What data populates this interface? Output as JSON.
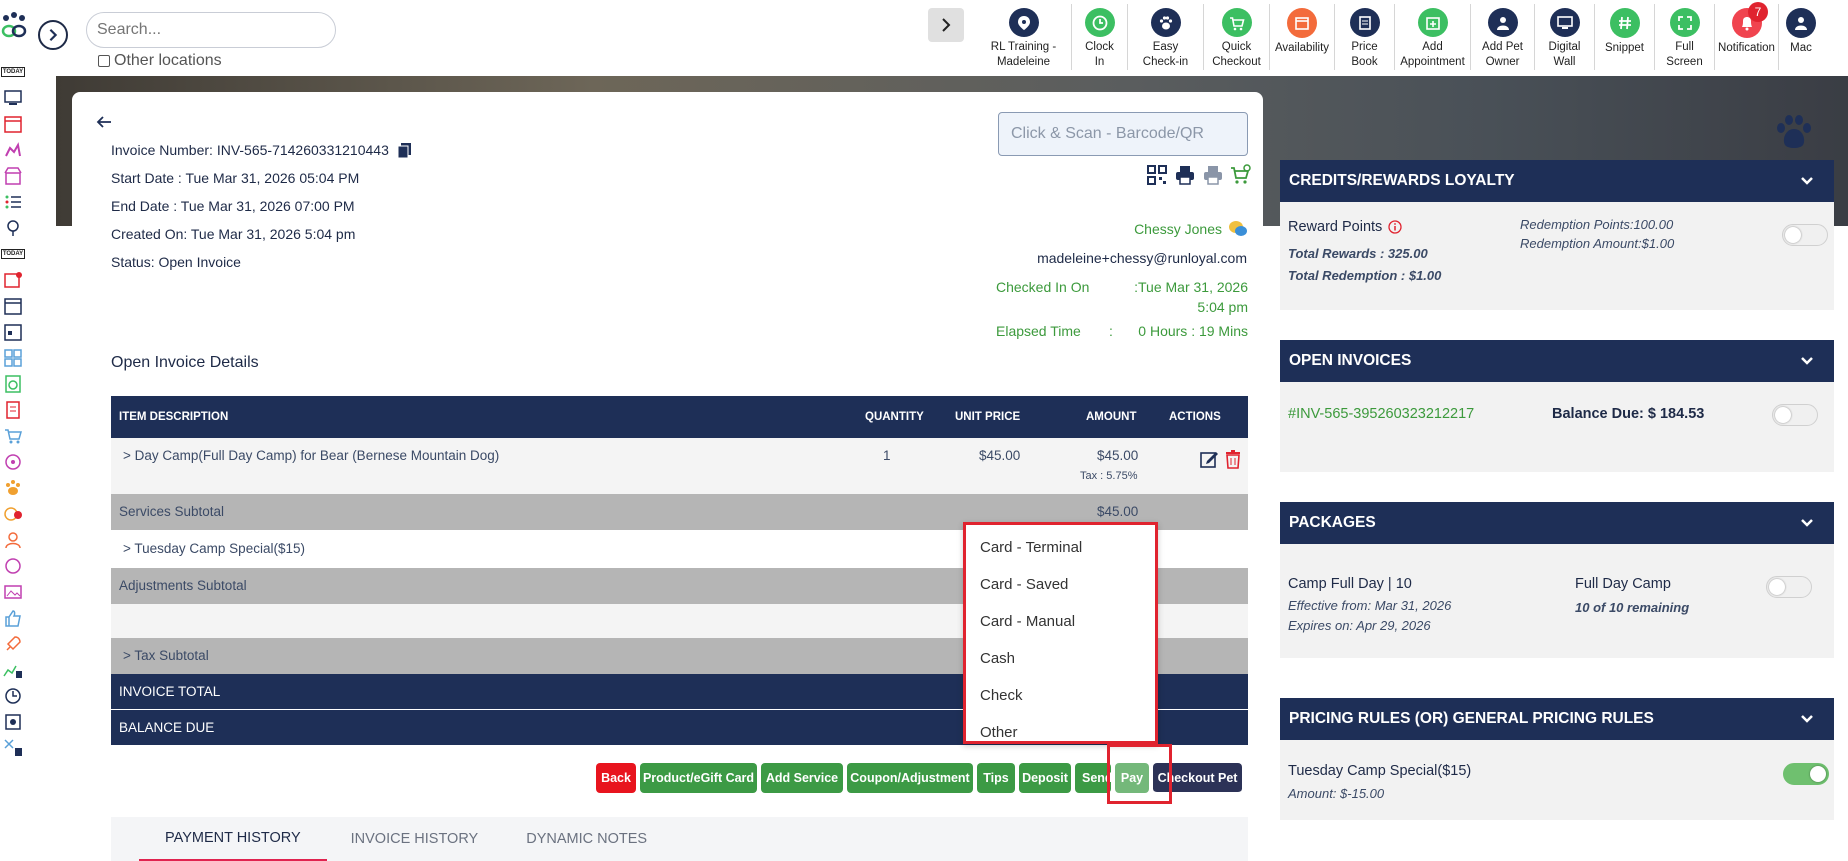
{
  "search": {
    "placeholder": "Search...",
    "other_locations": "Other locations"
  },
  "toolbar": [
    {
      "label": "RL Training -",
      "label2": "Madeleine",
      "color": "#1e2f57",
      "icon": "location-pin-icon"
    },
    {
      "label": "Clock",
      "label2": "In",
      "color": "#3cbf62",
      "icon": "clock-icon"
    },
    {
      "label": "Easy",
      "label2": "Check-in",
      "color": "#1e2f57",
      "icon": "paw-icon"
    },
    {
      "label": "Quick",
      "label2": "Checkout",
      "color": "#3cbf62",
      "icon": "cart-icon"
    },
    {
      "label": "Availability",
      "label2": "",
      "color": "#f36b3b",
      "icon": "calendar-icon"
    },
    {
      "label": "Price",
      "label2": "Book",
      "color": "#1e2f57",
      "icon": "book-icon"
    },
    {
      "label": "Add",
      "label2": "Appointment",
      "color": "#3cbf62",
      "icon": "calendar-plus-icon"
    },
    {
      "label": "Add Pet",
      "label2": "Owner",
      "color": "#1e2f57",
      "icon": "user-plus-icon"
    },
    {
      "label": "Digital",
      "label2": "Wall",
      "color": "#1e2f57",
      "icon": "monitor-icon"
    },
    {
      "label": "Snippet",
      "label2": "",
      "color": "#3cbf62",
      "icon": "hash-icon"
    },
    {
      "label": "Full",
      "label2": "Screen",
      "color": "#3cbf62",
      "icon": "expand-icon"
    },
    {
      "label": "Notification",
      "label2": "",
      "color": "#f0444f",
      "icon": "bell-icon",
      "badge": "7"
    },
    {
      "label": "Mac",
      "label2": "",
      "color": "#1e2f57",
      "icon": "user-icon"
    }
  ],
  "invoice": {
    "number": "Invoice Number: INV-565-714260331210443",
    "start": "Start Date : Tue Mar 31, 2026 05:04 PM",
    "end": "End Date : Tue Mar 31, 2026 07:00 PM",
    "created": "Created On: Tue Mar 31, 2026 5:04 pm",
    "status": "Status: Open Invoice"
  },
  "scan_placeholder": "Click & Scan - Barcode/QR",
  "customer": {
    "name": "Chessy Jones",
    "email": "madeleine+chessy@runloyal.com",
    "checked_in_label": "Checked In On",
    "checked_in_value": ":Tue Mar 31, 2026 5:04 pm",
    "elapsed_label": "Elapsed Time",
    "elapsed_sep": ":",
    "elapsed_value": "0 Hours : 19 Mins"
  },
  "section_title": "Open Invoice Details",
  "table": {
    "headers": [
      "ITEM DESCRIPTION",
      "QUANTITY",
      "UNIT PRICE",
      "AMOUNT",
      "ACTIONS"
    ],
    "item": {
      "desc": ">  Day Camp(Full Day Camp) for Bear (Bernese Mountain Dog)",
      "qty": "1",
      "unit": "$45.00",
      "amount": "$45.00",
      "tax": "Tax : 5.75%"
    },
    "services_subtotal": "Services Subtotal",
    "services_amount": "$45.00",
    "adjustment": ">  Tuesday Camp Special($15)",
    "adjustments_subtotal": "Adjustments Subtotal",
    "tax_subtotal": ">  Tax Subtotal",
    "invoice_total": "INVOICE TOTAL",
    "balance_due": "BALANCE DUE"
  },
  "pay_options": [
    "Card - Terminal",
    "Card - Saved",
    "Card - Manual",
    "Cash",
    "Check",
    "Other"
  ],
  "buttons": {
    "back": "Back",
    "product": "Product/eGift Card",
    "add_service": "Add Service",
    "coupon": "Coupon/Adjustment",
    "tips": "Tips",
    "deposit": "Deposit",
    "send": "Send",
    "pay": "Pay",
    "checkout": "Checkout Pet"
  },
  "tabs": [
    "PAYMENT HISTORY",
    "INVOICE HISTORY",
    "DYNAMIC NOTES"
  ],
  "panels": {
    "credits": {
      "title": "CREDITS/REWARDS LOYALTY",
      "reward_points": "Reward Points",
      "total_rewards": "Total Rewards : 325.00",
      "total_redemption": "Total Redemption : $1.00",
      "redemption_points": "Redemption Points:100.00",
      "redemption_amount": "Redemption Amount:$1.00"
    },
    "open_invoices": {
      "title": "OPEN INVOICES",
      "invoice": "#INV-565-395260323212217",
      "balance": "Balance Due: $ 184.53"
    },
    "packages": {
      "title": "PACKAGES",
      "name": "Camp Full Day | 10",
      "effective": "Effective from: Mar 31, 2026",
      "expires": "Expires on: Apr 29, 2026",
      "service": "Full Day Camp",
      "remaining": "10 of 10 remaining"
    },
    "pricing": {
      "title": "PRICING RULES (OR) GENERAL PRICING RULES",
      "rule": "Tuesday Camp Special($15)",
      "amount": "Amount: $-15.00"
    }
  }
}
